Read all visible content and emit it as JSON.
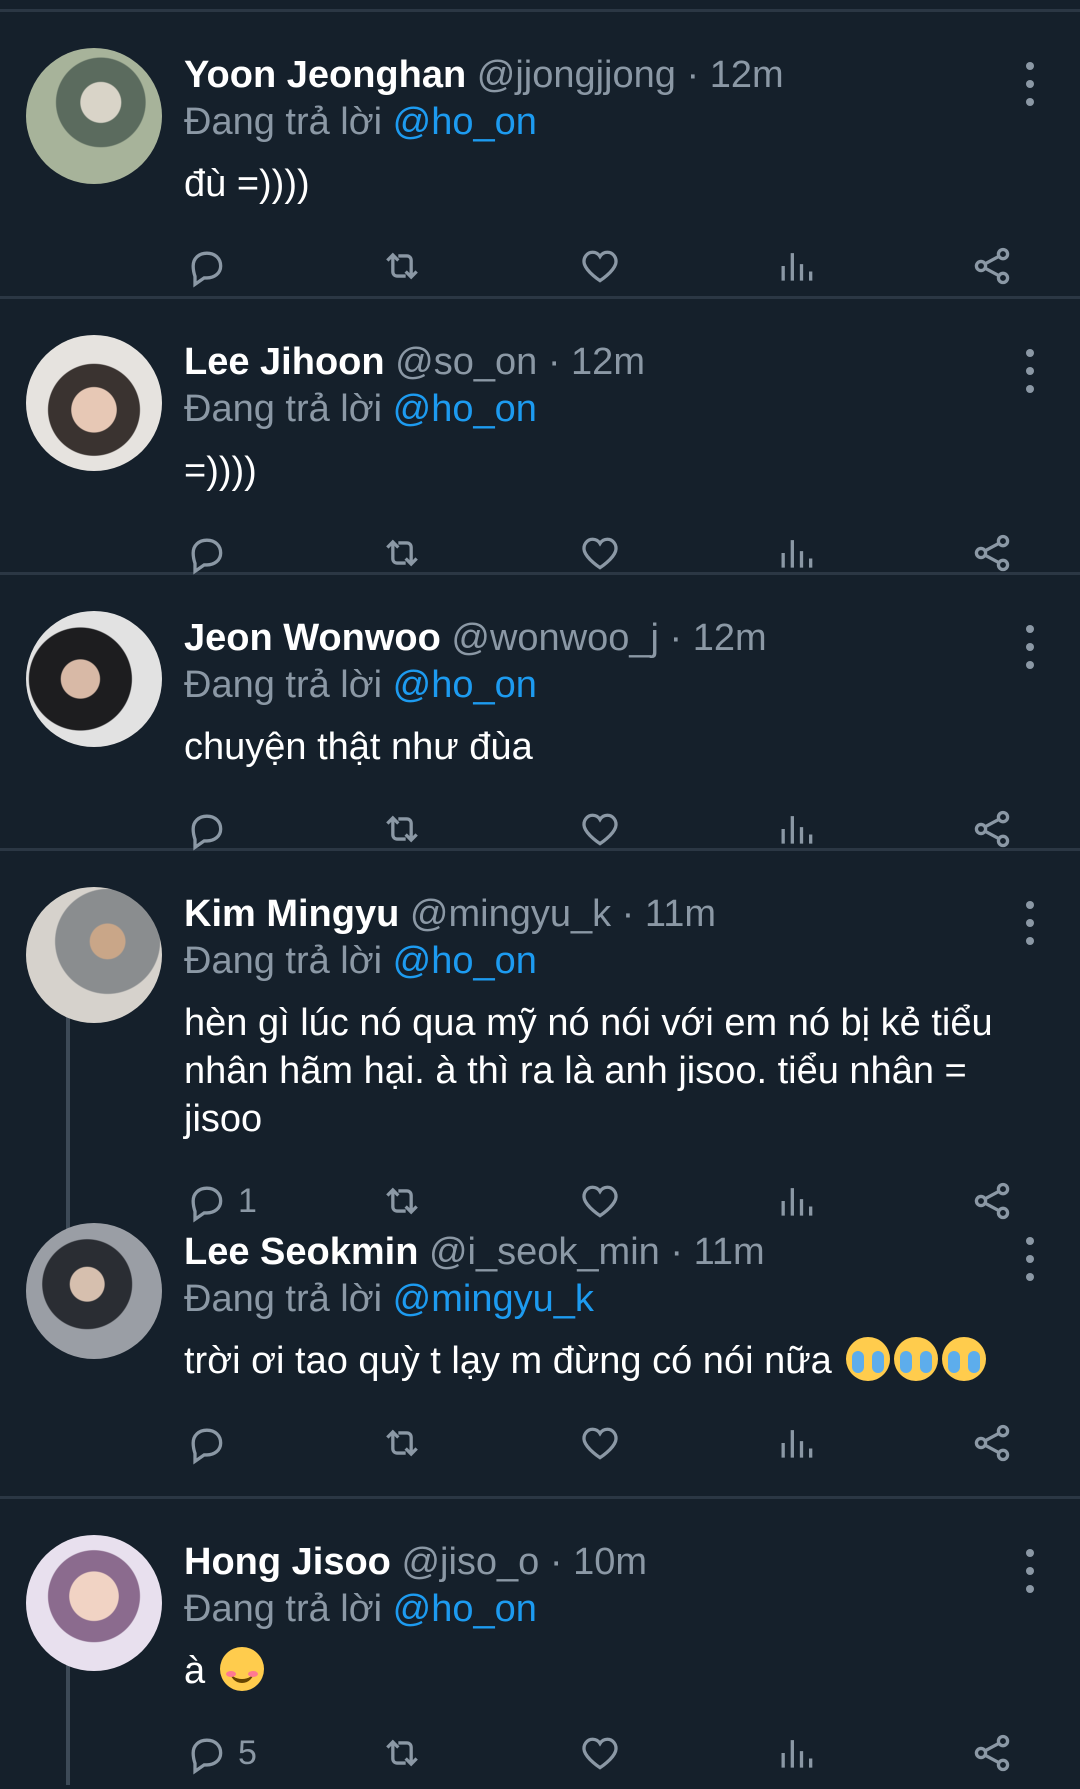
{
  "colors": {
    "background": "#15202b",
    "divider": "#2b3744",
    "secondary_text": "#8b98a5",
    "mention": "#1d9bf0"
  },
  "icons": {
    "reply": "reply-icon",
    "retweet": "retweet-icon",
    "like": "heart-icon",
    "views": "bar-chart-icon",
    "share": "share-icon",
    "more": "more-vertical-icon"
  },
  "tweets": [
    {
      "name": "Yoon Jeonghan",
      "handle": "@jjongjjong",
      "separator": "·",
      "time": "12m",
      "replying_prefix": "Đang trả lời",
      "replying_to": "@ho_on",
      "text": "đù =))))",
      "reply_count": ""
    },
    {
      "name": "Lee Jihoon",
      "handle": "@so_on",
      "separator": "·",
      "time": "12m",
      "replying_prefix": "Đang trả lời",
      "replying_to": "@ho_on",
      "text": "=))))",
      "reply_count": ""
    },
    {
      "name": "Jeon Wonwoo",
      "handle": "@wonwoo_j",
      "separator": "·",
      "time": "12m",
      "replying_prefix": "Đang trả lời",
      "replying_to": "@ho_on",
      "text": "chuyện thật như đùa",
      "reply_count": ""
    },
    {
      "name": "Kim Mingyu",
      "handle": "@mingyu_k",
      "separator": "·",
      "time": "11m",
      "replying_prefix": "Đang trả lời",
      "replying_to": "@ho_on",
      "text": "hèn gì lúc nó qua mỹ nó nói với em nó bị kẻ tiểu nhân hãm hại. à thì ra là anh jisoo. tiểu nhân = jisoo",
      "reply_count": "1"
    },
    {
      "name": "Lee Seokmin",
      "handle": "@i_seok_min",
      "separator": "·",
      "time": "11m",
      "replying_prefix": "Đang trả lời",
      "replying_to": "@mingyu_k",
      "text": "trời ơi tao quỳ t lạy m đừng có nói nữa",
      "emoji": "crying-face-emoji",
      "reply_count": ""
    },
    {
      "name": "Hong Jisoo",
      "handle": "@jiso_o",
      "separator": "·",
      "time": "10m",
      "replying_prefix": "Đang trả lời",
      "replying_to": "@ho_on",
      "text": "à",
      "emoji": "smiling-face-emoji",
      "reply_count": "5"
    }
  ]
}
